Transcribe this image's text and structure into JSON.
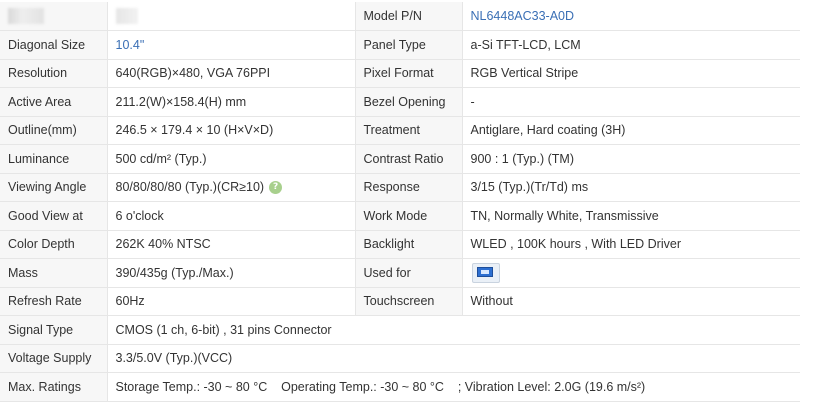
{
  "rows": [
    {
      "label": "",
      "value": "",
      "label2": "Model P/N",
      "value2": "NL6448AC33-A0D"
    },
    {
      "label": "Diagonal Size",
      "value": "10.4\"",
      "label2": "Panel Type",
      "value2": "a-Si TFT-LCD, LCM"
    },
    {
      "label": "Resolution",
      "value": "640(RGB)×480, VGA  76PPI",
      "label2": "Pixel Format",
      "value2": "RGB Vertical Stripe"
    },
    {
      "label": "Active Area",
      "value": "211.2(W)×158.4(H) mm",
      "label2": "Bezel Opening",
      "value2": "-"
    },
    {
      "label": "Outline(mm)",
      "value": "246.5 × 179.4 × 10 (H×V×D)",
      "label2": "Treatment",
      "value2": "Antiglare, Hard coating (3H)"
    },
    {
      "label": "Luminance",
      "value": "500 cd/m² (Typ.)",
      "label2": "Contrast Ratio",
      "value2": "900 : 1 (Typ.) (TM)"
    },
    {
      "label": "Viewing Angle",
      "value": "80/80/80/80 (Typ.)(CR≥10)",
      "label2": "Response",
      "value2": "3/15 (Typ.)(Tr/Td) ms"
    },
    {
      "label": "Good View at",
      "value": "6 o'clock",
      "label2": "Work Mode",
      "value2": "TN, Normally White, Transmissive"
    },
    {
      "label": "Color Depth",
      "value": "262K   40% NTSC",
      "label2": "Backlight",
      "value2": "WLED , 100K hours , With LED Driver"
    },
    {
      "label": "Mass",
      "value": "390/435g (Typ./Max.)",
      "label2": "Used for",
      "value2": ""
    },
    {
      "label": "Refresh Rate",
      "value": "60Hz",
      "label2": "Touchscreen",
      "value2": "Without"
    },
    {
      "label": "Signal Type",
      "value": "CMOS (1 ch, 6-bit) , 31 pins Connector"
    },
    {
      "label": "Voltage Supply",
      "value": "3.3/5.0V (Typ.)(VCC)"
    },
    {
      "label": "Max. Ratings",
      "value": "Storage Temp.: -30 ~ 80 °C    Operating Temp.: -30 ~ 80 °C    ; Vibration Level: 2.0G (19.6 m/s²)"
    }
  ],
  "icons": {
    "help": "question-mark-circle-icon",
    "used_for": "industrial-device-icon"
  },
  "colors": {
    "label_bg": "#f7f7f7",
    "border": "#e6e6e6",
    "model_value": "#3a6fb5",
    "help_icon": "#a8d08d"
  }
}
